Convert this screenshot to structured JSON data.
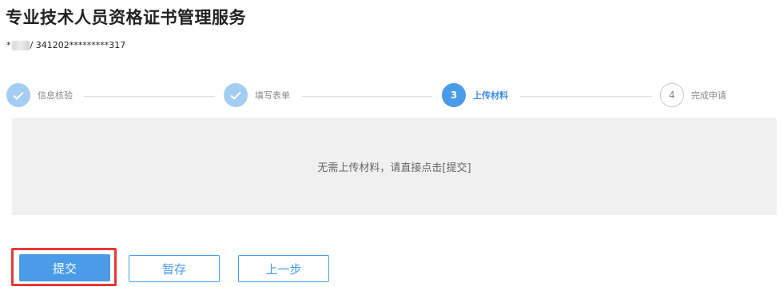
{
  "page": {
    "title": "专业技术人员资格证书管理服务"
  },
  "user": {
    "id_prefix": "*",
    "id_suffix": "/ 341202*********317"
  },
  "steps": [
    {
      "number": "",
      "label": "信息核验",
      "state": "done"
    },
    {
      "number": "",
      "label": "填写表单",
      "state": "done"
    },
    {
      "number": "3",
      "label": "上传材料",
      "state": "active"
    },
    {
      "number": "4",
      "label": "完成申请",
      "state": "todo"
    }
  ],
  "panel": {
    "message": "无需上传材料，请直接点击[提交]"
  },
  "buttons": {
    "submit": "提交",
    "save": "暂存",
    "prev": "上一步"
  },
  "colors": {
    "primary": "#4a9ce8",
    "done": "#a3cdf3",
    "highlight": "#e53935"
  }
}
